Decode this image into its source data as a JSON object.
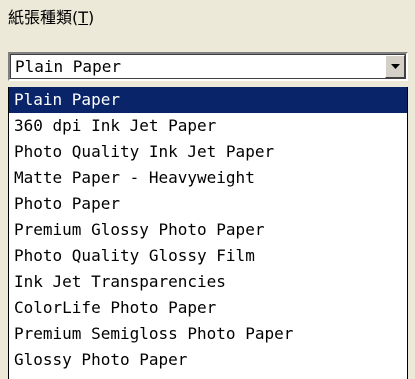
{
  "label": {
    "text": "紙張種類(",
    "mnemonic": "T",
    "suffix": ")"
  },
  "combo": {
    "value": "Plain Paper",
    "button_icon": "chevron-down-icon"
  },
  "options": [
    "Plain Paper",
    "360 dpi Ink Jet Paper",
    "Photo Quality Ink Jet Paper",
    "Matte Paper - Heavyweight",
    "Photo Paper",
    "Premium Glossy Photo Paper",
    "Photo Quality Glossy Film",
    "Ink Jet Transparencies",
    "ColorLife Photo Paper",
    "Premium Semigloss Photo Paper",
    "Glossy Photo Paper"
  ],
  "selected_index": 0,
  "colors": {
    "selection_bg": "#0a246a",
    "selection_fg": "#ffffff",
    "dialog_bg": "#ece9d8"
  }
}
